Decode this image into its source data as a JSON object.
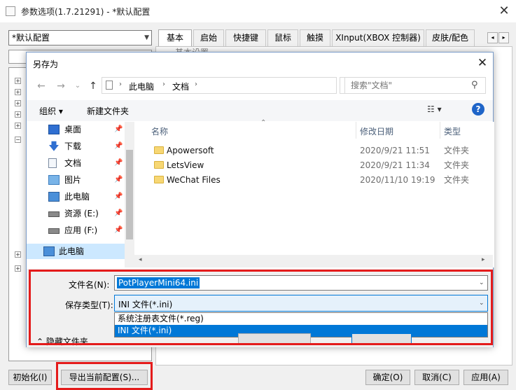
{
  "background_window": {
    "title": "参数选项(1.7.21291) - *默认配置",
    "config_combo": "*默认配置",
    "tabs": [
      "基本",
      "启始",
      "快捷键",
      "鼠标",
      "触摸",
      "XInput(XBOX 控制器)",
      "皮肤/配色"
    ],
    "panel_title": "基本设置",
    "buttons": {
      "init": "初始化(I)",
      "export": "导出当前配置(S)...",
      "ok": "确定(O)",
      "cancel": "取消(C)",
      "apply": "应用(A)"
    }
  },
  "dialog": {
    "title": "另存为",
    "address": {
      "crumbs": [
        "此电脑",
        "文档"
      ]
    },
    "search_placeholder": "搜索\"文档\"",
    "toolbar": {
      "organize": "组织 ▾",
      "new_folder": "新建文件夹"
    },
    "nav_items": [
      {
        "label": "桌面",
        "icon": "desktop-icon"
      },
      {
        "label": "下载",
        "icon": "download-icon"
      },
      {
        "label": "文档",
        "icon": "document-icon"
      },
      {
        "label": "图片",
        "icon": "pictures-icon"
      },
      {
        "label": "此电脑",
        "icon": "computer-icon"
      },
      {
        "label": "资源 (E:)",
        "icon": "drive-icon"
      },
      {
        "label": "应用 (F:)",
        "icon": "drive-icon"
      }
    ],
    "nav_selected": "此电脑",
    "columns": {
      "name": "名称",
      "date": "修改日期",
      "type": "类型"
    },
    "files": [
      {
        "name": "Apowersoft",
        "date": "2020/9/21 11:51",
        "type": "文件夹"
      },
      {
        "name": "LetsView",
        "date": "2020/9/21 11:34",
        "type": "文件夹"
      },
      {
        "name": "WeChat Files",
        "date": "2020/11/10 19:19",
        "type": "文件夹"
      }
    ],
    "filename_label": "文件名(N):",
    "filename_value": "PotPlayerMini64.ini",
    "filetype_label": "保存类型(T):",
    "filetype_value": "INI 文件(*.ini)",
    "filetype_options": [
      "系统注册表文件(*.reg)",
      "INI 文件(*.ini)"
    ],
    "hide_folders": "隐藏文件夹"
  },
  "colors": {
    "highlight_border": "#e41b1b",
    "selection_blue": "#0078d7",
    "nav_selected_bg": "#cce8ff"
  }
}
